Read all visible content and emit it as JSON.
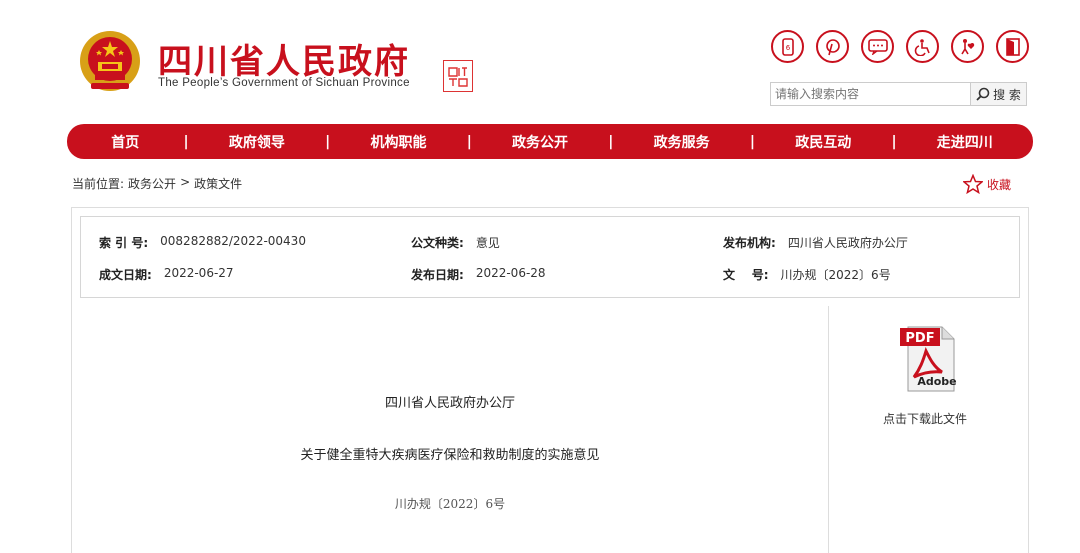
{
  "header": {
    "title": "四川省人民政府",
    "subtitle": "The People’s Government of Sichuan Province",
    "seal_text": "中国四川",
    "tools": [
      {
        "name": "mobile-icon"
      },
      {
        "name": "pinterest-icon"
      },
      {
        "name": "chat-icon"
      },
      {
        "name": "accessibility-icon"
      },
      {
        "name": "elderly-care-icon"
      },
      {
        "name": "exit-icon"
      }
    ],
    "search": {
      "placeholder": "请输入搜索内容",
      "button_label": "搜 索"
    }
  },
  "nav": {
    "items": [
      "首页",
      "政府领导",
      "机构职能",
      "政务公开",
      "政务服务",
      "政民互动",
      "走进四川"
    ]
  },
  "breadcrumb": {
    "prefix": "当前位置:",
    "items": [
      "政务公开",
      "政策文件"
    ],
    "separator": ">"
  },
  "favorite_label": "收藏",
  "meta": {
    "index_label": "索 引 号:",
    "index_value": "008282882/2022-00430",
    "type_label": "公文种类:",
    "type_value": "意见",
    "publisher_label": "发布机构:",
    "publisher_value": "四川省人民政府办公厅",
    "created_label": "成文日期:",
    "created_value": "2022-06-27",
    "published_label": "发布日期:",
    "published_value": "2022-06-28",
    "docnum_label": "文    号:",
    "docnum_value": "川办规〔2022〕6号"
  },
  "document": {
    "org": "四川省人民政府办公厅",
    "title": "关于健全重特大疾病医疗保险和救助制度的实施意见",
    "number": "川办规〔2022〕6号"
  },
  "download": {
    "pdf_text": "PDF",
    "adobe_text": "Adobe",
    "label": "点击下载此文件"
  },
  "colors": {
    "brand_red": "#c8101d"
  }
}
